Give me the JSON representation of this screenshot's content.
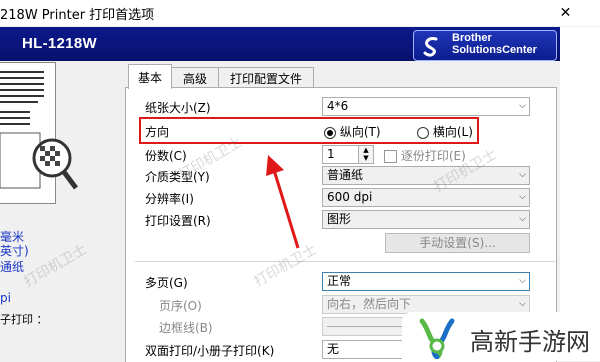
{
  "window": {
    "title": "218W Printer 打印首选项",
    "close_glyph": "✕"
  },
  "banner": {
    "model": "HL-1218W",
    "bsc_line1": "Brother",
    "bsc_line2": "SolutionsCenter"
  },
  "tabs": [
    {
      "label": "基本",
      "active": true
    },
    {
      "label": "高级",
      "active": false
    },
    {
      "label": "打印配置文件",
      "active": false
    }
  ],
  "sidebar": {
    "line1": "毫米",
    "line2": "英寸)",
    "line3": "通纸",
    "line4": "pi",
    "line5": "子打印 ："
  },
  "settings": {
    "paper_size": {
      "label": "纸张大小(Z)",
      "value": "4*6"
    },
    "orientation": {
      "label": "方向",
      "portrait": "纵向(T)",
      "landscape": "横向(L)",
      "selected": "portrait"
    },
    "copies": {
      "label": "份数(C)",
      "value": "1",
      "collate": "逐份打印(E)"
    },
    "media_type": {
      "label": "介质类型(Y)",
      "value": "普通纸"
    },
    "resolution": {
      "label": "分辨率(I)",
      "value": "600 dpi"
    },
    "print_settings": {
      "label": "打印设置(R)",
      "value": "图形"
    },
    "manual_button": "手动设置(S)...",
    "multi_page": {
      "label": "多页(G)",
      "value": "正常"
    },
    "page_order": {
      "label": "页序(O)",
      "value": "向右，然后向下"
    },
    "border": {
      "label": "边框线(B)"
    },
    "duplex": {
      "label": "双面打印/小册子打印(K)",
      "value": "无"
    }
  },
  "watermark": "打印机卫士",
  "badge": {
    "text": "高新手游网"
  },
  "colors": {
    "banner": "#0a147a",
    "highlight": "#e01818",
    "badge_green": "#58b947",
    "badge_blue": "#1b6fc4"
  }
}
